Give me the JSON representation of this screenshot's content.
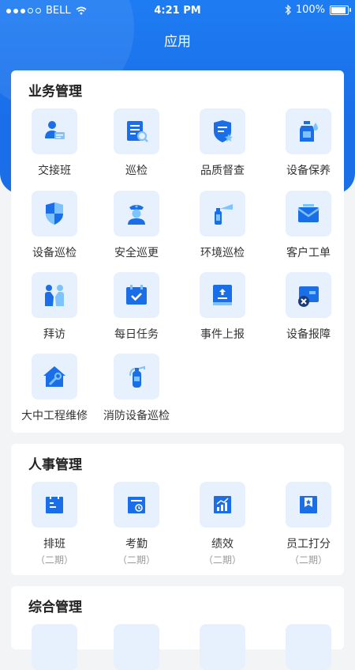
{
  "status_bar": {
    "carrier": "BELL",
    "time": "4:21 PM",
    "battery": "100%"
  },
  "page_title": "应用",
  "sections": [
    {
      "title": "业务管理",
      "items": [
        {
          "label": "交接班",
          "icon": "handover-icon"
        },
        {
          "label": "巡检",
          "icon": "inspection-icon"
        },
        {
          "label": "品质督查",
          "icon": "quality-shield-icon"
        },
        {
          "label": "设备保养",
          "icon": "maintenance-bottle-icon"
        },
        {
          "label": "设备巡检",
          "icon": "equipment-shield-icon"
        },
        {
          "label": "安全巡更",
          "icon": "security-guard-icon"
        },
        {
          "label": "环境巡检",
          "icon": "spray-icon"
        },
        {
          "label": "客户工单",
          "icon": "envelope-icon"
        },
        {
          "label": "拜访",
          "icon": "visit-people-icon"
        },
        {
          "label": "每日任务",
          "icon": "calendar-check-icon"
        },
        {
          "label": "事件上报",
          "icon": "upload-report-icon"
        },
        {
          "label": "设备报障",
          "icon": "device-fault-icon"
        },
        {
          "label": "大中工程维修",
          "icon": "house-repair-icon"
        },
        {
          "label": "消防设备巡检",
          "icon": "fire-extinguisher-icon"
        }
      ]
    },
    {
      "title": "人事管理",
      "items": [
        {
          "label": "排班",
          "sub": "（二期）",
          "icon": "schedule-icon"
        },
        {
          "label": "考勤",
          "sub": "（二期）",
          "icon": "attendance-icon"
        },
        {
          "label": "绩效",
          "sub": "（二期）",
          "icon": "performance-chart-icon"
        },
        {
          "label": "员工打分",
          "sub": "（二期）",
          "icon": "rating-icon"
        }
      ]
    },
    {
      "title": "综合管理"
    }
  ],
  "colors": {
    "primary": "#1a6fe9",
    "tile_bg": "#e7f0fd",
    "accent_light": "#7cc3ff"
  }
}
